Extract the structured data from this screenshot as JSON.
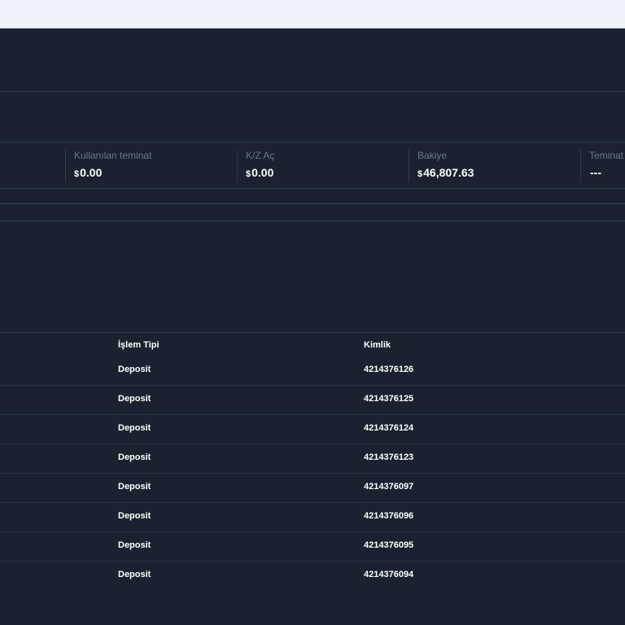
{
  "stats": [
    {
      "label": "Kullanılan teminat",
      "currency": "$",
      "value": "0.00"
    },
    {
      "label": "K/Z Aç",
      "currency": "$",
      "value": "0.00"
    },
    {
      "label": "Bakiye",
      "currency": "$",
      "value": "46,807.63"
    },
    {
      "label": "Teminat",
      "currency": "",
      "value": "---"
    }
  ],
  "table": {
    "headers": {
      "type": "İşlem Tipi",
      "id": "Kimlik"
    },
    "rows": [
      {
        "type": "Deposit",
        "id": "4214376126"
      },
      {
        "type": "Deposit",
        "id": "4214376125"
      },
      {
        "type": "Deposit",
        "id": "4214376124"
      },
      {
        "type": "Deposit",
        "id": "4214376123"
      },
      {
        "type": "Deposit",
        "id": "4214376097"
      },
      {
        "type": "Deposit",
        "id": "4214376096"
      },
      {
        "type": "Deposit",
        "id": "4214376095"
      },
      {
        "type": "Deposit",
        "id": "4214376094"
      }
    ]
  },
  "colors": {
    "background": "#19222e",
    "topbar": "#edf1f8",
    "label": "#6c7889",
    "value": "#ffffff"
  }
}
